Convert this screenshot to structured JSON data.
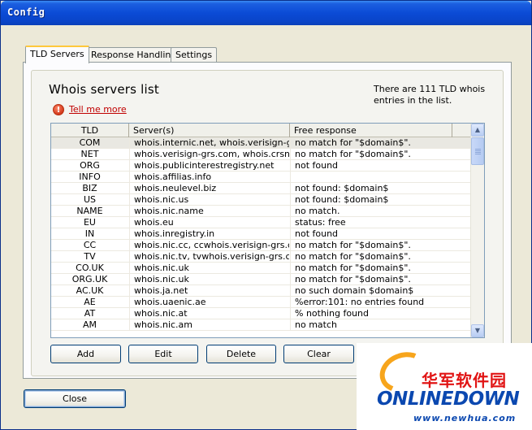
{
  "window": {
    "title": "Config"
  },
  "tabs": [
    {
      "label": "TLD Servers",
      "active": true
    },
    {
      "label": "Response Handling",
      "active": false
    },
    {
      "label": "Settings",
      "active": false
    }
  ],
  "panel": {
    "heading": "Whois servers list",
    "count_text": "There are 111 TLD whois entries in the list.",
    "help_link": "Tell me more",
    "help_icon": "!"
  },
  "table": {
    "columns": [
      "TLD",
      "Server(s)",
      "Free response"
    ],
    "rows": [
      {
        "tld": "COM",
        "servers": "whois.internic.net, whois.verisign-gr...",
        "free": "no match for \"$domain$\"."
      },
      {
        "tld": "NET",
        "servers": "whois.verisign-grs.com, whois.crsnic...",
        "free": "no match for \"$domain$\"."
      },
      {
        "tld": "ORG",
        "servers": "whois.publicinterestregistry.net",
        "free": "not found"
      },
      {
        "tld": "INFO",
        "servers": "whois.affilias.info",
        "free": ""
      },
      {
        "tld": "BIZ",
        "servers": "whois.neulevel.biz",
        "free": "not found: $domain$"
      },
      {
        "tld": "US",
        "servers": "whois.nic.us",
        "free": "not found: $domain$"
      },
      {
        "tld": "NAME",
        "servers": "whois.nic.name",
        "free": "no match."
      },
      {
        "tld": "EU",
        "servers": "whois.eu",
        "free": "status:      free"
      },
      {
        "tld": "IN",
        "servers": "whois.inregistry.in",
        "free": "not found"
      },
      {
        "tld": "CC",
        "servers": "whois.nic.cc, ccwhois.verisign-grs.com",
        "free": "no match for \"$domain$\"."
      },
      {
        "tld": "TV",
        "servers": "whois.nic.tv, tvwhois.verisign-grs.com",
        "free": "no match for \"$domain$\"."
      },
      {
        "tld": "CO.UK",
        "servers": "whois.nic.uk",
        "free": "no match for \"$domain$\"."
      },
      {
        "tld": "ORG.UK",
        "servers": "whois.nic.uk",
        "free": "no match for \"$domain$\"."
      },
      {
        "tld": "AC.UK",
        "servers": "whois.ja.net",
        "free": "no such domain $domain$"
      },
      {
        "tld": "AE",
        "servers": "whois.uaenic.ae",
        "free": "%error:101: no entries found"
      },
      {
        "tld": "AT",
        "servers": "whois.nic.at",
        "free": "% nothing found"
      },
      {
        "tld": "AM",
        "servers": "whois.nic.am",
        "free": "no match"
      }
    ]
  },
  "buttons": {
    "add": "Add",
    "edit": "Edit",
    "delete": "Delete",
    "clear": "Clear",
    "close": "Close"
  },
  "logo": {
    "cn": "华军软件园",
    "main": "ONLINEDOWN",
    "url": "www.newhua.com"
  },
  "colors": {
    "titlebar": "#0b4bd6",
    "accent_tab": "#ffc83c",
    "link": "#c00000",
    "logo_blue": "#0b48b0",
    "logo_red": "#e11414"
  }
}
